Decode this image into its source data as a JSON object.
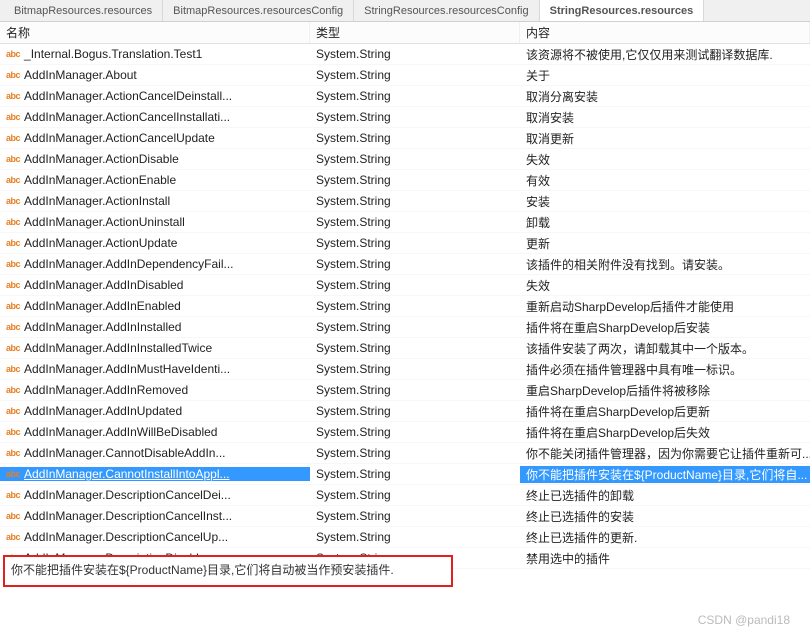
{
  "tabs": [
    {
      "label": "BitmapResources.resources"
    },
    {
      "label": "BitmapResources.resourcesConfig"
    },
    {
      "label": "StringResources.resourcesConfig"
    },
    {
      "label": "StringResources.resources",
      "active": true
    }
  ],
  "columns": {
    "name": "名称",
    "type": "类型",
    "content": "内容"
  },
  "rows": [
    {
      "name": "_Internal.Bogus.Translation.Test1",
      "type": "System.String",
      "content": "该资源将不被使用,它仅仅用来测试翻译数据库."
    },
    {
      "name": "AddInManager.About",
      "type": "System.String",
      "content": "关于"
    },
    {
      "name": "AddInManager.ActionCancelDeinstall...",
      "type": "System.String",
      "content": "取消分离安装"
    },
    {
      "name": "AddInManager.ActionCancelInstallati...",
      "type": "System.String",
      "content": "取消安装"
    },
    {
      "name": "AddInManager.ActionCancelUpdate",
      "type": "System.String",
      "content": "取消更新"
    },
    {
      "name": "AddInManager.ActionDisable",
      "type": "System.String",
      "content": "失效"
    },
    {
      "name": "AddInManager.ActionEnable",
      "type": "System.String",
      "content": "有效"
    },
    {
      "name": "AddInManager.ActionInstall",
      "type": "System.String",
      "content": "安装"
    },
    {
      "name": "AddInManager.ActionUninstall",
      "type": "System.String",
      "content": "卸载"
    },
    {
      "name": "AddInManager.ActionUpdate",
      "type": "System.String",
      "content": "更新"
    },
    {
      "name": "AddInManager.AddInDependencyFail...",
      "type": "System.String",
      "content": "该插件的相关附件没有找到。请安装。"
    },
    {
      "name": "AddInManager.AddInDisabled",
      "type": "System.String",
      "content": "失效"
    },
    {
      "name": "AddInManager.AddInEnabled",
      "type": "System.String",
      "content": "重新启动SharpDevelop后插件才能使用"
    },
    {
      "name": "AddInManager.AddInInstalled",
      "type": "System.String",
      "content": "插件将在重启SharpDevelop后安装"
    },
    {
      "name": "AddInManager.AddInInstalledTwice",
      "type": "System.String",
      "content": "该插件安装了两次，请卸载其中一个版本。"
    },
    {
      "name": "AddInManager.AddInMustHaveIdenti...",
      "type": "System.String",
      "content": "插件必须在插件管理器中具有唯一标识。"
    },
    {
      "name": "AddInManager.AddInRemoved",
      "type": "System.String",
      "content": "重启SharpDevelop后插件将被移除"
    },
    {
      "name": "AddInManager.AddInUpdated",
      "type": "System.String",
      "content": "插件将在重启SharpDevelop后更新"
    },
    {
      "name": "AddInManager.AddInWillBeDisabled",
      "type": "System.String",
      "content": "插件将在重启SharpDevelop后失效"
    },
    {
      "name": "AddInManager.CannotDisableAddIn...",
      "type": "System.String",
      "content": "你不能关闭插件管理器，因为你需要它让插件重新可..."
    },
    {
      "name": "AddInManager.CannotInstallIntoAppl...",
      "type": "System.String",
      "content": "你不能把插件安装在${ProductName}目录,它们将自...",
      "selected": true
    },
    {
      "name": "AddInManager.DescriptionCancelDei...",
      "type": "System.String",
      "content": "终止已选插件的卸载"
    },
    {
      "name": "AddInManager.DescriptionCancelInst...",
      "type": "System.String",
      "content": "终止已选插件的安装"
    },
    {
      "name": "AddInManager.DescriptionCancelUp...",
      "type": "System.String",
      "content": "终止已选插件的更新."
    },
    {
      "name": "AddInManager.DescriptionDisable",
      "type": "System.String",
      "content": "禁用选中的插件"
    }
  ],
  "detail": "你不能把插件安装在${ProductName}目录,它们将自动被当作预安装插件.",
  "watermark": "CSDN @pandi18"
}
